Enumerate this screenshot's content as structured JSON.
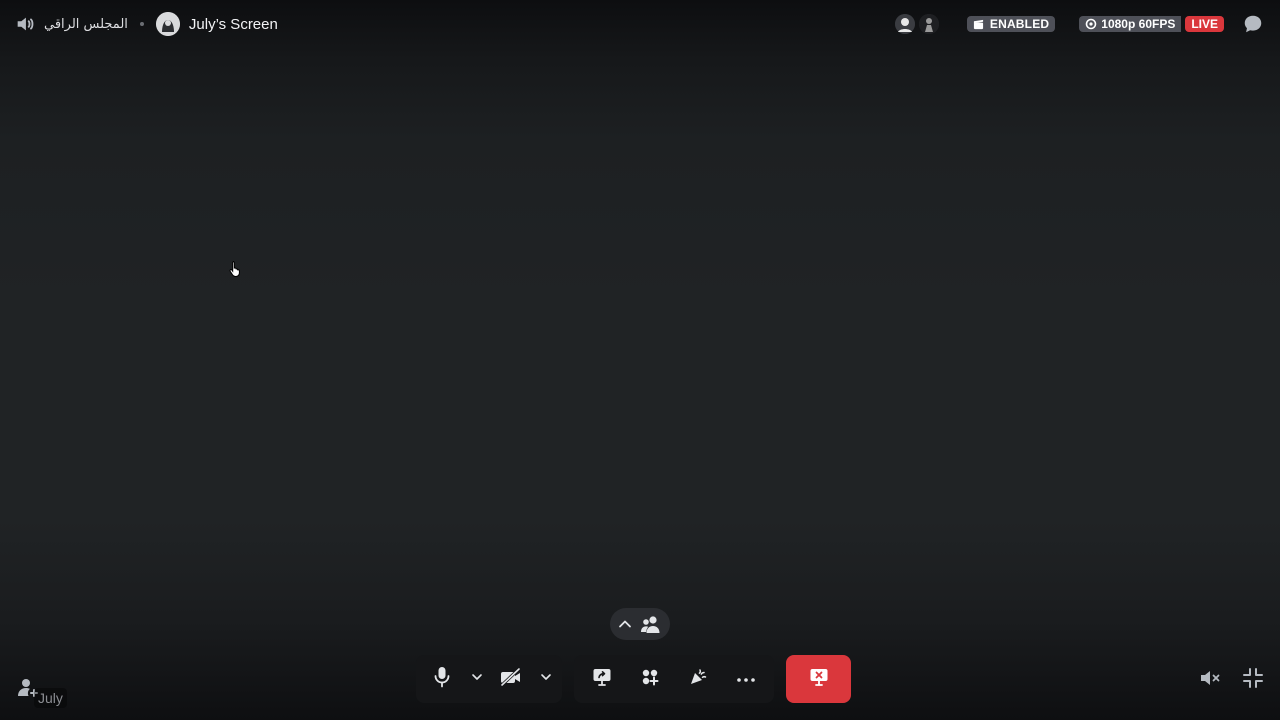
{
  "header": {
    "channel_name": "المجلس الراقي",
    "screen_title": "July’s Screen",
    "status_badge": "ENABLED",
    "quality_badge": "1080p 60FPS",
    "live_badge": "LIVE"
  },
  "participants": {
    "name_tag": "July"
  },
  "icons": {
    "channel": "speaker-icon",
    "avatar": "user-avatar",
    "viewer_1": "viewer-avatar",
    "viewer_2": "viewer-avatar",
    "enabled": "clapperboard-icon",
    "quality": "eye-icon",
    "chat": "chat-bubble-icon",
    "microphone": "microphone-icon",
    "camera_off": "camera-off-icon",
    "screen_share": "screen-share-icon",
    "activities": "activities-icon",
    "soundboard": "soundboard-icon",
    "more": "more-icon",
    "disconnect": "screen-share-stop-icon",
    "volume_mute": "volume-mute-icon",
    "exit_fullscreen": "exit-fullscreen-icon",
    "add_people": "add-people-icon",
    "participants": "participants-icon",
    "chevron_up": "chevron-up-icon"
  },
  "colors": {
    "live": "#da373c",
    "badge": "#4e5058",
    "disconnect": "#da373c"
  }
}
